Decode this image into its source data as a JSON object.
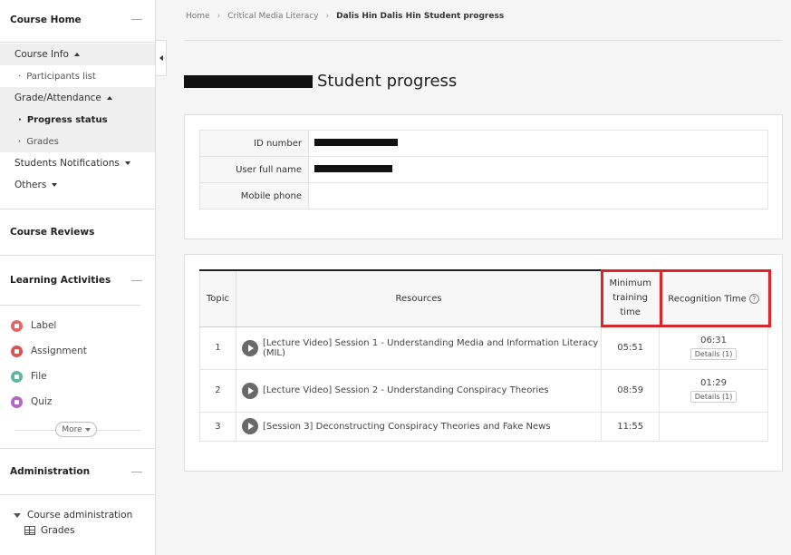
{
  "sidebar": {
    "course_home": "Course Home",
    "course_info": "Course Info",
    "participants_list": "Participants list",
    "grade_attendance": "Grade/Attendance",
    "progress_status": "Progress status",
    "grades": "Grades",
    "students_notifications": "Students Notifications",
    "others": "Others",
    "course_reviews": "Course Reviews",
    "learning_activities": "Learning Activities",
    "activities": [
      {
        "label": "Label",
        "color": "#e0686a"
      },
      {
        "label": "Assignment",
        "color": "#d9534f"
      },
      {
        "label": "File",
        "color": "#5cb8a4"
      },
      {
        "label": "Quiz",
        "color": "#b565c7"
      }
    ],
    "more": "More",
    "administration": "Administration",
    "course_administration": "Course administration",
    "admin_grades": "Grades"
  },
  "breadcrumb": {
    "home": "Home",
    "course": "Critical Media Literacy",
    "current": "Dalis Hin Dalis Hin Student progress"
  },
  "page_title_suffix": "Student progress",
  "student_info": {
    "id_label": "ID number",
    "name_label": "User full name",
    "phone_label": "Mobile phone"
  },
  "progress_table": {
    "headers": {
      "topic": "Topic",
      "resources": "Resources",
      "min_time_1": "Minimum",
      "min_time_2": "training",
      "min_time_3": "time",
      "recognition": "Recognition Time",
      "help": "?"
    },
    "rows": [
      {
        "topic": "1",
        "resource": "[Lecture Video] Session 1 - Understanding Media and Information Literacy (MIL)",
        "min_time": "05:51",
        "recognition": "06:31",
        "details": "Details (1)"
      },
      {
        "topic": "2",
        "resource": "[Lecture Video] Session 2 - Understanding Conspiracy Theories",
        "min_time": "08:59",
        "recognition": "01:29",
        "details": "Details (1)"
      },
      {
        "topic": "3",
        "resource": "[Session 3] Deconstructing Conspiracy Theories and Fake News",
        "min_time": "11:55",
        "recognition": "",
        "details": ""
      }
    ]
  },
  "colors": {
    "highlight": "#d9262b",
    "redaction": "#111111"
  }
}
